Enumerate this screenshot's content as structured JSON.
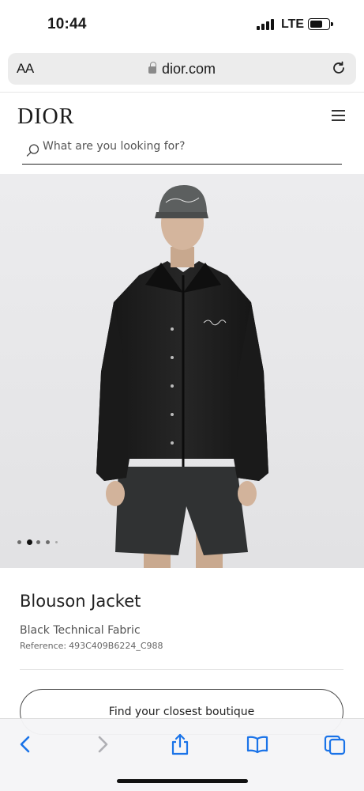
{
  "status": {
    "time": "10:44",
    "network": "LTE",
    "battery_level": 0.7
  },
  "browser": {
    "aa_label": "AA",
    "url": "dior.com",
    "lock_icon": "lock-icon",
    "reload_icon": "reload-icon"
  },
  "header": {
    "logo": "DIOR",
    "menu_icon": "hamburger-menu-icon",
    "search_placeholder": "What are you looking for?",
    "search_icon": "search-icon"
  },
  "carousel": {
    "total": 5,
    "active": 2
  },
  "product": {
    "title": "Blouson Jacket",
    "subtitle": "Black Technical Fabric",
    "reference_label": "Reference:",
    "reference_value": "493C409B6224_C988",
    "boutique_button": "Find your closest boutique"
  },
  "toolbar": {
    "items": [
      "back-icon",
      "forward-icon",
      "share-icon",
      "bookmarks-icon",
      "tabs-icon"
    ],
    "accent": "#1a73e8",
    "disabled": "#b0b0b5"
  }
}
